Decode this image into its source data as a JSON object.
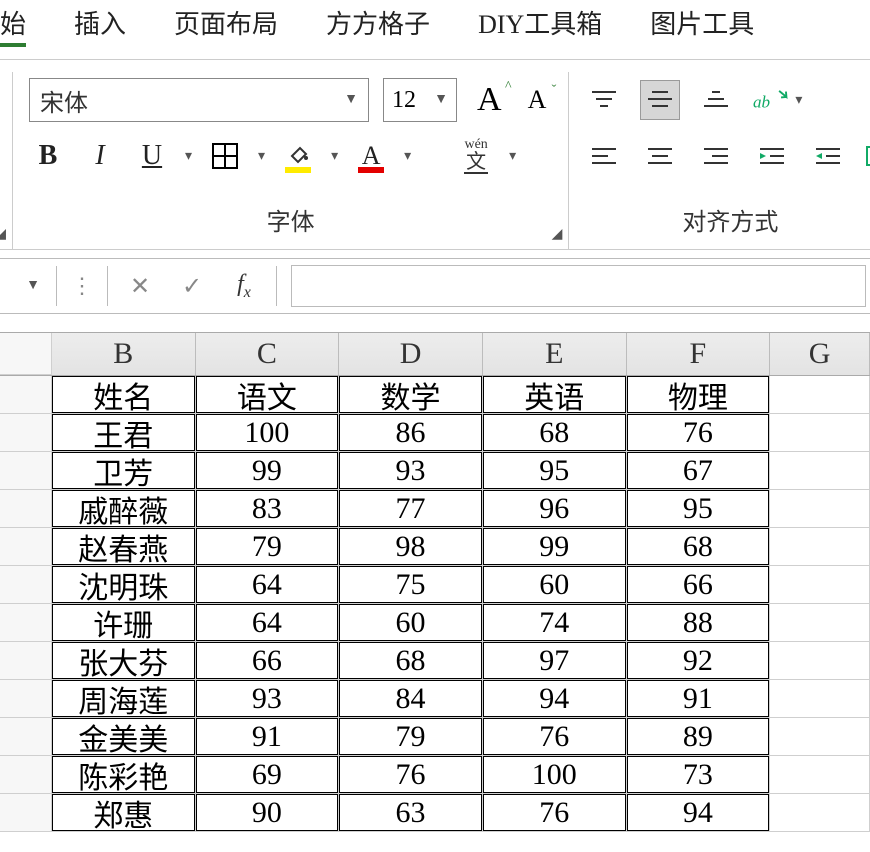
{
  "menu": {
    "home": "始",
    "insert": "插入",
    "page_layout": "页面布局",
    "fanggezi": "方方格子",
    "diy": "DIY工具箱",
    "image_tools": "图片工具"
  },
  "font_group": {
    "font_name": "宋体",
    "font_size": "12",
    "label": "字体"
  },
  "align_group": {
    "label": "对齐方式"
  },
  "columns": [
    "B",
    "C",
    "D",
    "E",
    "F",
    "G"
  ],
  "table": {
    "headers": [
      "姓名",
      "语文",
      "数学",
      "英语",
      "物理"
    ],
    "rows": [
      [
        "王君",
        "100",
        "86",
        "68",
        "76"
      ],
      [
        "卫芳",
        "99",
        "93",
        "95",
        "67"
      ],
      [
        "戚醉薇",
        "83",
        "77",
        "96",
        "95"
      ],
      [
        "赵春燕",
        "79",
        "98",
        "99",
        "68"
      ],
      [
        "沈明珠",
        "64",
        "75",
        "60",
        "66"
      ],
      [
        "许珊",
        "64",
        "60",
        "74",
        "88"
      ],
      [
        "张大芬",
        "66",
        "68",
        "97",
        "92"
      ],
      [
        "周海莲",
        "93",
        "84",
        "94",
        "91"
      ],
      [
        "金美美",
        "91",
        "79",
        "76",
        "89"
      ],
      [
        "陈彩艳",
        "69",
        "76",
        "100",
        "73"
      ],
      [
        "郑惠",
        "90",
        "63",
        "76",
        "94"
      ]
    ]
  },
  "chart_data": {
    "type": "table",
    "title": "",
    "columns": [
      "姓名",
      "语文",
      "数学",
      "英语",
      "物理"
    ],
    "rows": [
      {
        "姓名": "王君",
        "语文": 100,
        "数学": 86,
        "英语": 68,
        "物理": 76
      },
      {
        "姓名": "卫芳",
        "语文": 99,
        "数学": 93,
        "英语": 95,
        "物理": 67
      },
      {
        "姓名": "戚醉薇",
        "语文": 83,
        "数学": 77,
        "英语": 96,
        "物理": 95
      },
      {
        "姓名": "赵春燕",
        "语文": 79,
        "数学": 98,
        "英语": 99,
        "物理": 68
      },
      {
        "姓名": "沈明珠",
        "语文": 64,
        "数学": 75,
        "英语": 60,
        "物理": 66
      },
      {
        "姓名": "许珊",
        "语文": 64,
        "数学": 60,
        "英语": 74,
        "物理": 88
      },
      {
        "姓名": "张大芬",
        "语文": 66,
        "数学": 68,
        "英语": 97,
        "物理": 92
      },
      {
        "姓名": "周海莲",
        "语文": 93,
        "数学": 84,
        "英语": 94,
        "物理": 91
      },
      {
        "姓名": "金美美",
        "语文": 91,
        "数学": 79,
        "英语": 76,
        "物理": 89
      },
      {
        "姓名": "陈彩艳",
        "语文": 69,
        "数学": 76,
        "英语": 100,
        "物理": 73
      },
      {
        "姓名": "郑惠",
        "语文": 90,
        "数学": 63,
        "英语": 76,
        "物理": 94
      }
    ]
  }
}
